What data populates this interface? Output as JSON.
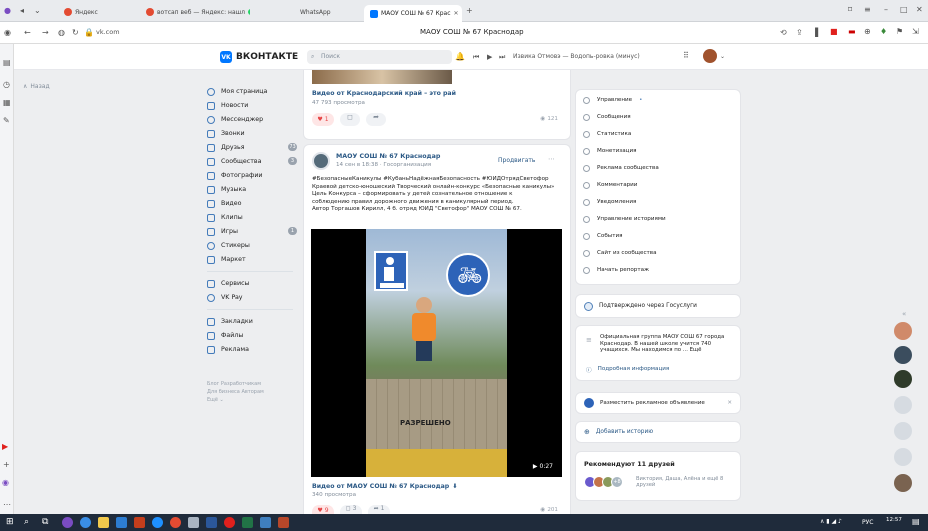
{
  "browser": {
    "tabs": [
      {
        "label": "Яндекс",
        "color": "#e34b32"
      },
      {
        "label": "вотсап веб — Яндекс: нашл",
        "color": "#e34b32"
      },
      {
        "label": "WhatsApp",
        "color": "#25d366"
      },
      {
        "label": "МАОУ СОШ № 67 Крас",
        "color": "#0077ff"
      }
    ],
    "url": "vk.com",
    "page_title": "МАОУ СОШ № 67 Краснодар"
  },
  "vk": {
    "logo_text": "ВКОНТАКТЕ",
    "search_placeholder": "Поиск",
    "player_text": "Извика Отмовэ — Водопь-ровка (минус)",
    "left_label": "Назад",
    "menu": [
      {
        "label": "Моя страница",
        "badge": ""
      },
      {
        "label": "Новости",
        "badge": ""
      },
      {
        "label": "Мессенджер",
        "badge": ""
      },
      {
        "label": "Звонки",
        "badge": ""
      },
      {
        "label": "Друзья",
        "badge": "73"
      },
      {
        "label": "Сообщества",
        "badge": "3"
      },
      {
        "label": "Фотографии",
        "badge": ""
      },
      {
        "label": "Музыка",
        "badge": ""
      },
      {
        "label": "Видео",
        "badge": ""
      },
      {
        "label": "Клипы",
        "badge": ""
      },
      {
        "label": "Игры",
        "badge": "1"
      },
      {
        "label": "Стикеры",
        "badge": ""
      },
      {
        "label": "Маркет",
        "badge": ""
      },
      {
        "label": "Сервисы",
        "badge": ""
      },
      {
        "label": "VK Pay",
        "badge": ""
      },
      {
        "label": "Закладки",
        "badge": ""
      },
      {
        "label": "Файлы",
        "badge": ""
      },
      {
        "label": "Реклама",
        "badge": ""
      }
    ],
    "footer_links": "Блог  Разработчикам\nДля бизнеса  Авторам\nЕщё ⌄"
  },
  "feed": {
    "top_video_title": "Видео от Краснодарский край – это рай",
    "top_video_views": "47 793 просмотра",
    "top_likes": "1",
    "top_views": "121",
    "post": {
      "author": "МАОУ СОШ № 67 Краснодар",
      "date": "14 сен в 18:38 · Госорганизация",
      "promote": "Продвигать",
      "text": "#БезопасныеКаникулы #КубаньНадёжнаяБезопасность #ЮИДОтрядСветофор\nКраевой детско-юношеский Творческий онлайн-конкурс «Безопасные каникулы»\nЦель Конкурса – сформировать у детей сознательное отношение к\nсоблюдению правил дорожного движения в каникулярный период.\nАвтор Торгашов Кирилл, 4 б. отряд ЮИД \"Светофор\" МАОУ СОШ № 67.",
      "video_caption": "РАЗРЕШЕНО",
      "duration": "0:27",
      "video_title": "Видео от МАОУ СОШ № 67 Краснодар",
      "video_views": "340 просмотра",
      "likes": "9",
      "comments": "3",
      "shares": "1",
      "views": "201"
    }
  },
  "right_panel": {
    "items": [
      "Управление",
      "Сообщения",
      "Статистика",
      "Монетизация",
      "Реклама сообщества",
      "Комментарии",
      "Уведомления",
      "Управление историями",
      "События",
      "Сайт из сообщества",
      "Начать репортаж"
    ],
    "verified": "Подтверждено через Госуслуги",
    "about": "Официальная группа МАОУ СОШ 67 города Краснодар. В нашей школе учится 740 учащихся. Мы находимся по ... Ещё",
    "about_more": "Подробная информация",
    "ad": "Разместить рекламное объявление",
    "stories": "Добавить историю",
    "friends_title": "Рекомендуют 11 друзей",
    "friends_names": "Виктория, Даша, Алёна и ещё 8 друзей",
    "friends_extra": "+8"
  },
  "taskbar": {
    "lang": "РУС",
    "time": "12:57"
  }
}
